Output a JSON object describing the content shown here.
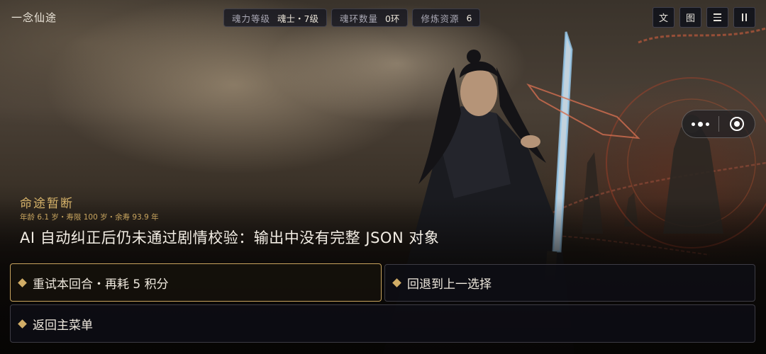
{
  "app": {
    "title": "一念仙途"
  },
  "stats": [
    {
      "label": "魂力等级",
      "value": "魂士・7级"
    },
    {
      "label": "魂环数量",
      "value": "0环"
    },
    {
      "label": "修炼资源",
      "value": "6"
    }
  ],
  "toolbar": {
    "text_label": "文",
    "image_label": "图",
    "menu_icon": "menu-icon",
    "pause_icon": "pause-icon"
  },
  "capsule": {
    "more_icon": "more-dots-icon",
    "close_icon": "target-circle-icon"
  },
  "story": {
    "chapter": "命途暂断",
    "age_line": "年龄 6.1 岁・寿限 100 岁・余寿 93.9 年",
    "message": "AI 自动纠正后仍未通过剧情校验：输出中没有完整 JSON 对象"
  },
  "choices": [
    {
      "label": "重试本回合・再耗 5 积分",
      "active": true
    },
    {
      "label": "回退到上一选择",
      "active": false
    },
    {
      "label": "返回主菜单",
      "active": false
    }
  ],
  "colors": {
    "accent_gold": "#d1ad66",
    "panel_bg": "#0e0e16"
  }
}
